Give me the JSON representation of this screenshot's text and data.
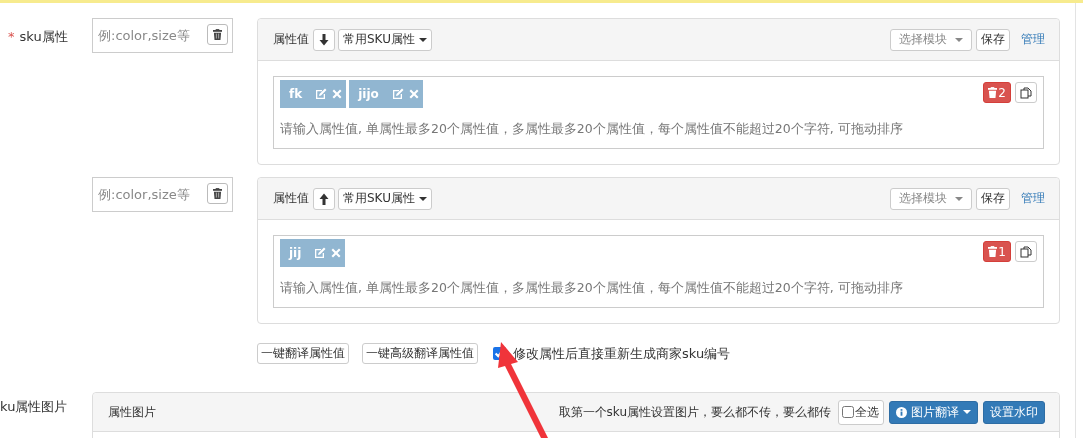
{
  "sku_attributes": {
    "required_mark": "*",
    "label": "sku属性",
    "groups": [
      {
        "name_placeholder": "例:color,size等",
        "header_label": "属性值",
        "sort_button": {
          "kind": "down"
        },
        "common_dropdown": "常用SKU属性",
        "module_select": "选择模块",
        "save": "保存",
        "manage": "管理",
        "values": [
          {
            "text": "fk"
          },
          {
            "text": "jijo"
          }
        ],
        "hint": "请输入属性值, 单属性最多20个属性值，多属性最多20个属性值，每个属性值不能超过20个字符, 可拖动排序",
        "delete_count": "2"
      },
      {
        "name_placeholder": "例:color,size等",
        "header_label": "属性值",
        "sort_button": {
          "kind": "up"
        },
        "common_dropdown": "常用SKU属性",
        "module_select": "选择模块",
        "save": "保存",
        "manage": "管理",
        "values": [
          {
            "text": "jij"
          }
        ],
        "hint": "请输入属性值, 单属性最多20个属性值，多属性最多20个属性值，每个属性值不能超过20个字符, 可拖动排序",
        "delete_count": "1"
      }
    ]
  },
  "actions": {
    "translate": "一键翻译属性值",
    "advanced_translate": "一键高级翻译属性值",
    "regenerate": {
      "label": "修改属性后直接重新生成商家sku编号",
      "checked": true
    }
  },
  "image_section": {
    "label": "ku属性图片",
    "title": "属性图片",
    "note": "取第一个sku属性设置图片，要么都不传，要么都传",
    "select_all": {
      "label": "全选",
      "checked": false
    },
    "translate_button": "图片翻译",
    "watermark_button": "设置水印"
  }
}
